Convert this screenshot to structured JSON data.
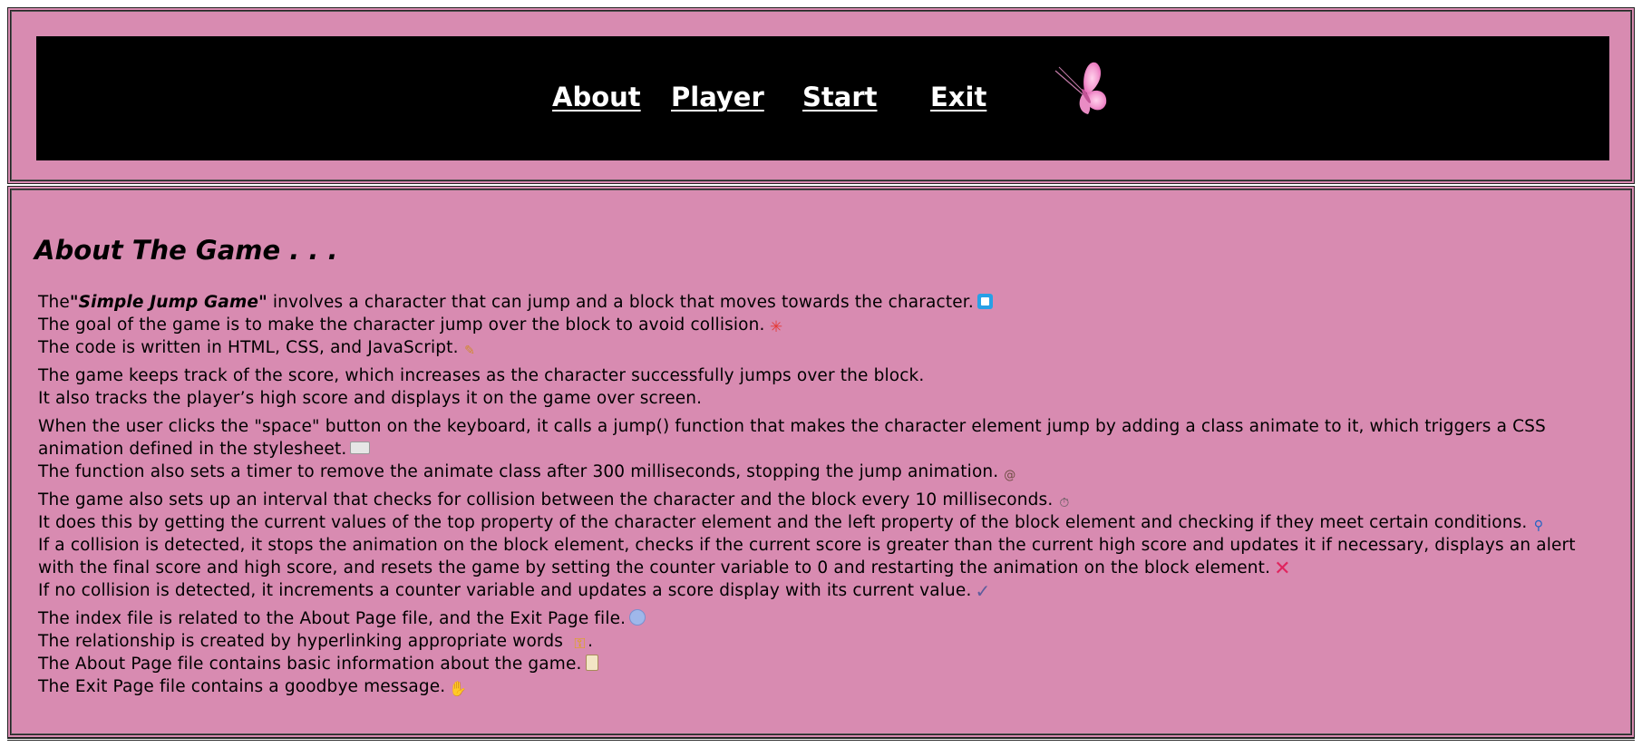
{
  "nav": {
    "about_label": "About",
    "player_label": "Player",
    "start_label": "Start",
    "exit_label": "Exit"
  },
  "colors": {
    "background": "#d88bb1",
    "navbar": "#000000",
    "nav_text": "#ffffff",
    "butterfly": "#f39ad0"
  },
  "about": {
    "title": "About The Game . . .",
    "p1": {
      "l1_prefix": "The",
      "l1_game_name": "\"Simple Jump Game\"",
      "l1_rest": " involves a character that can jump and a block that moves towards the character.",
      "l1_icon": "blue-square-icon",
      "l2": "The goal of the game is to make the character jump over the block to avoid collision.",
      "l2_icon": "anger-symbol-icon",
      "l3": "The code is written in HTML, CSS, and JavaScript.",
      "l3_icon": "memo-icon"
    },
    "p2": {
      "l1": "The game keeps track of the score, which increases as the character successfully jumps over the block.",
      "l2": "It also tracks the player’s high score and displays it on the game over screen."
    },
    "p3": {
      "l1": "When the user clicks the \"space\" button on the keyboard, it calls a jump() function that makes the character element jump by adding a class animate to it, which triggers a CSS animation defined in the stylesheet.",
      "l1_icon": "keyboard-icon",
      "l2": "The function also sets a timer to remove the animate class after 300 milliseconds, stopping the jump animation.",
      "l2_icon": "snail-icon"
    },
    "p4": {
      "l1": "The game also sets up an interval that checks for collision between the character and the block every 10 milliseconds.",
      "l1_icon": "stopwatch-icon",
      "l2": "It does this by getting the current values of the top property of the character element and the left property of the block element and checking if they meet certain conditions.",
      "l2_icon": "magnifier-icon",
      "l3": "If a collision is detected, it stops the animation on the block element, checks if the current score is greater than the current high score and updates it if necessary, displays an alert with the final score and high score, and resets the game by setting the counter variable to 0 and restarting the animation on the block element.",
      "l3_icon": "cross-mark-icon",
      "l4": "If no collision is detected, it increments a counter variable and updates a score display with its current value.",
      "l4_icon": "check-mark-icon"
    },
    "p5": {
      "l1": "The index file is related to the About Page file, and the Exit Page file.",
      "l1_icon": "globe-icon",
      "l2_prefix": "The relationship is created by hyperlinking appropriate words ",
      "l2_suffix": ".",
      "l2_icon": "key-icon",
      "l3": "The About Page file contains basic information about the game.",
      "l3_icon": "clipboard-icon",
      "l4": "The Exit Page file contains a goodbye message.",
      "l4_icon": "waving-hand-icon"
    }
  }
}
